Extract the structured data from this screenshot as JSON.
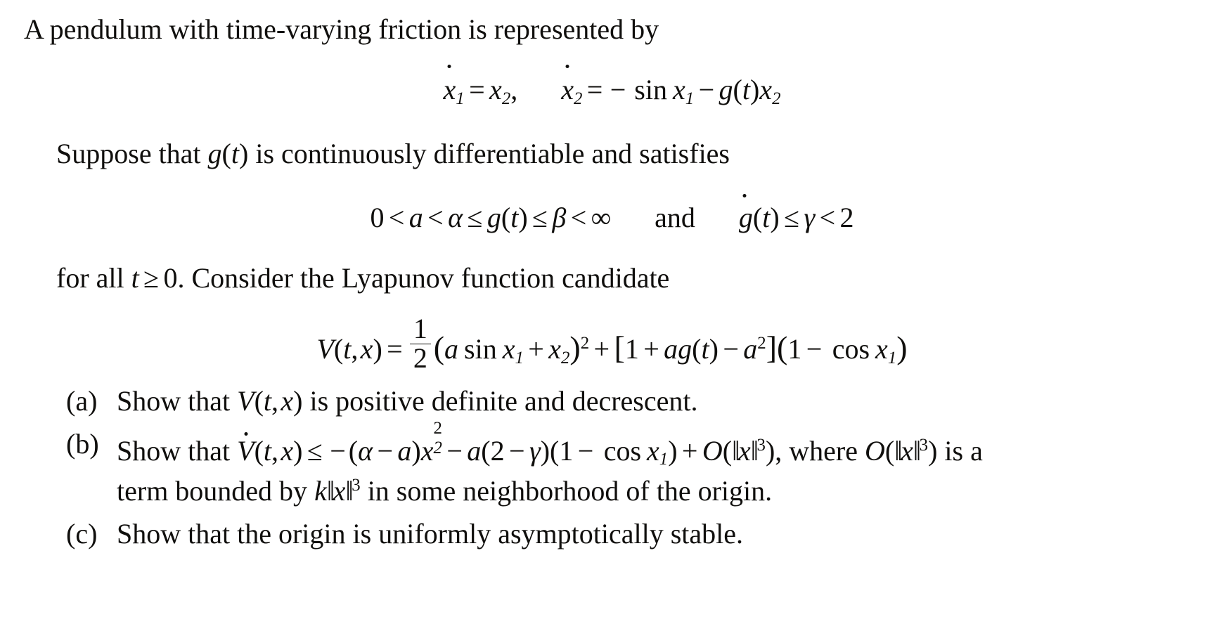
{
  "document": {
    "intro": {
      "text_1": "A pendulum with time-varying friction is represented by",
      "text_2_pre": "Suppose that ",
      "text_2_math": "g(t)",
      "text_2_post": " is continuously differentiable and satisfies",
      "text_3_pre": "for all ",
      "text_3_math": "t ≥ 0.",
      "text_3_post": "  Consider the Lyapunov function candidate"
    },
    "equations": {
      "dynamics": {
        "eq1_lhs": "x",
        "eq1_lhs_sub": "1",
        "eq1_eq": "=",
        "eq1_rhs": "x",
        "eq1_rhs_sub": "2",
        "eq1_comma": ",",
        "eq2_lhs": "x",
        "eq2_lhs_sub": "2",
        "eq2_eq": "=",
        "eq2_minus": "−",
        "eq2_sin": "sin",
        "eq2_x": "x",
        "eq2_x_sub": "1",
        "eq2_minus2": "−",
        "eq2_g": "g",
        "eq2_t": "t",
        "eq2_x2": "x",
        "eq2_x2_sub": "2",
        "plain": "ẋ₁ = x₂,    ẋ₂ = − sin x₁ − g(t)x₂"
      },
      "bounds": {
        "zero": "0",
        "lt1": "<",
        "a": "a",
        "lt2": "<",
        "alpha": "α",
        "le1": "≤",
        "g": "g",
        "t": "t",
        "le2": "≤",
        "beta": "β",
        "lt3": "<",
        "infinity": "∞",
        "and": "and",
        "gdot": "g",
        "t2": "t",
        "le3": "≤",
        "gamma": "γ",
        "lt4": "<",
        "two": "2",
        "plain": "0 < a < α ≤ g(t) ≤ β < ∞   and   ġ(t) ≤ γ < 2"
      },
      "lyapunov": {
        "V": "V",
        "t": "t",
        "comma": ",",
        "x": "x",
        "eq": "=",
        "frac_num": "1",
        "frac_den": "2",
        "a": "a",
        "sin": "sin",
        "x1": "x",
        "x1_sub": "1",
        "plus1": "+",
        "x2": "x",
        "x2_sub": "2",
        "sq": "2",
        "plus2": "+",
        "one": "1",
        "plus3": "+",
        "ag": "ag",
        "t2": "t",
        "minus": "−",
        "a2": "a",
        "a2_sup": "2",
        "one2": "1",
        "minus2": "−",
        "cos": "cos",
        "x1b": "x",
        "x1b_sub": "1",
        "plain": "V(t, x) = ½(a sin x₁ + x₂)² + [1 + ag(t) − a²](1 − cos x₁)"
      }
    },
    "problems": [
      {
        "marker": "(a)",
        "line1_pre": "Show that ",
        "line1_math": "V(t, x)",
        "line1_post": " is positive definite and decrescent.",
        "plain": "Show that V(t, x) is positive definite and decrescent."
      },
      {
        "marker": "(b)",
        "line1_pre": "Show that ",
        "line1_post": ", where ",
        "line1_post2": " is a",
        "line2_pre": "term bounded by ",
        "line2_post": " in some neighborhood of the origin.",
        "plain": "Show that V̇(t, x) ≤ −(α − a)x₂² − a(2 − γ)(1 − cos x₁) + O(‖x‖³), where O(‖x‖³) is a term bounded by k‖x‖³ in some neighborhood of the origin.",
        "tokens": {
          "Vdot": "V",
          "t": "t",
          "comma": ",",
          "x": "x",
          "le": "≤",
          "minus": "−",
          "alpha": "α",
          "minus2": "−",
          "a": "a",
          "x2": "x",
          "x2_sub": "2",
          "x2_sup": "2",
          "minus3": "−",
          "a2": "a",
          "two": "2",
          "minus4": "−",
          "gamma": "γ",
          "one": "1",
          "minus5": "−",
          "cos": "cos",
          "x1": "x",
          "x1_sub": "1",
          "plus": "+",
          "O": "O",
          "normx": "x",
          "cube": "3",
          "k": "k"
        }
      },
      {
        "marker": "(c)",
        "line1_pre": "Show that the origin is uniformly asymptotically stable.",
        "plain": "Show that the origin is uniformly asymptotically stable."
      }
    ]
  },
  "colors": {
    "text": "#100f0d",
    "background": "#ffffff"
  }
}
